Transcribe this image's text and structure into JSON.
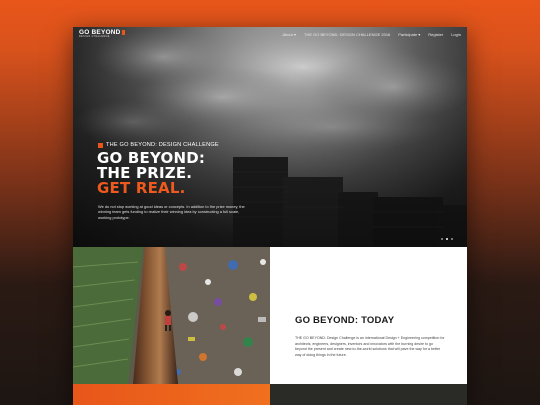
{
  "nav": {
    "logo_main": "GO BEYOND",
    "logo_sub": "DESIGN CHALLENGE",
    "items": [
      {
        "label": "About ▾"
      },
      {
        "label": "THE GO BEYOND: DESIGN CHALLENGE 2016"
      },
      {
        "label": "Participate ▾"
      },
      {
        "label": "Register"
      },
      {
        "label": "Login"
      }
    ]
  },
  "hero": {
    "eyebrow": "THE GO BEYOND: DESIGN CHALLENGE",
    "headline_1": "GO BEYOND:",
    "headline_2": "THE PRIZE.",
    "headline_3": "GET REAL.",
    "body": "We do not stop working at good ideas or concepts. In addition to the prize money, the winning team gets funding to realize their winning idea by constructing a full scale, working prototype.",
    "slide_count": 3,
    "active_slide": 1
  },
  "today": {
    "title": "GO BEYOND: TODAY",
    "body": "THE GO BEYOND: Design Challenge is an international Design + Engineering competition for architects, engineers, designers, inventors and innovators with the burning desire to go beyond the present and create new-to-the-world solutions that will pave the way for a better way of doing things in the future."
  },
  "colors": {
    "accent": "#e8561a",
    "dark": "#1c1c1c",
    "panel": "#ffffff"
  }
}
